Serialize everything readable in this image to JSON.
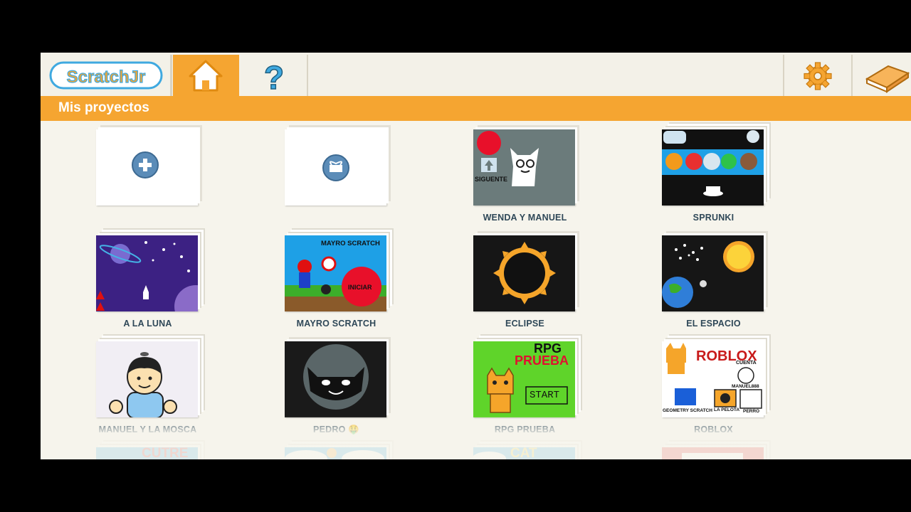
{
  "app": {
    "name": "ScratchJr"
  },
  "header": {
    "logo_text": "ScratchJr",
    "title": "Mis proyectos"
  },
  "projects": [
    {
      "label": ""
    },
    {
      "label": ""
    },
    {
      "label": "WENDA Y MANUEL",
      "thumb_text": "SIGUENTE"
    },
    {
      "label": "SPRUNKI"
    },
    {
      "label": "A LA LUNA"
    },
    {
      "label": "MAYRO SCRATCH",
      "thumb_text": "MAYRO SCRATCH",
      "thumb_button": "INICIAR"
    },
    {
      "label": "ECLIPSE"
    },
    {
      "label": "EL ESPACIO"
    },
    {
      "label": "MANUEL Y LA MOSCA"
    },
    {
      "label": "PEDRO 🤑"
    },
    {
      "label": "RPG PRUEBA",
      "thumb_title_1": "RPG",
      "thumb_title_2": "PRUEBA",
      "thumb_button": "START"
    },
    {
      "label": "ROBLOX",
      "thumb_title": "ROBLOX",
      "thumb_texts": [
        "CUENTA",
        "MANUEL888",
        "GEOMETRY SCRATCH",
        "LA PELOTA",
        "PERRO"
      ]
    },
    {
      "label": "",
      "thumb_text": "CUTRE"
    },
    {
      "label": ""
    },
    {
      "label": "",
      "thumb_text": "CAT"
    },
    {
      "label": ""
    }
  ],
  "colors": {
    "accent": "#f5a531",
    "background": "#f6f4ec",
    "label": "#2f4858",
    "icon_blue": "#5b8cb8"
  }
}
